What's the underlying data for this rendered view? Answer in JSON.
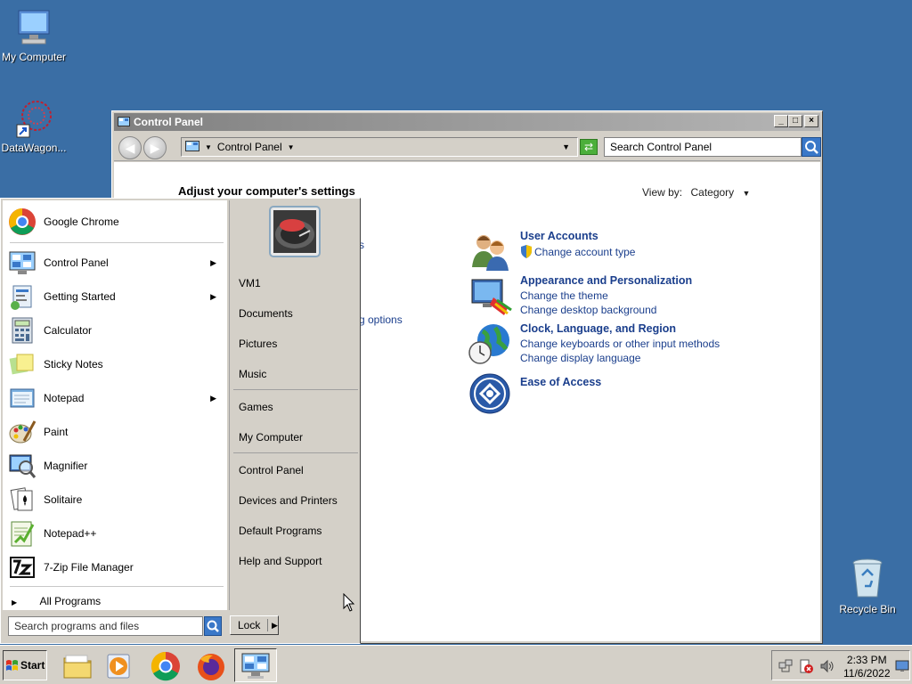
{
  "desktop": {
    "icons": [
      {
        "label": "My Computer"
      },
      {
        "label": "DataWagon..."
      },
      {
        "label": "Recycle Bin"
      }
    ]
  },
  "control_panel": {
    "title": "Control Panel",
    "address": "Control Panel",
    "search_placeholder": "Search Control Panel",
    "heading": "Adjust your computer's settings",
    "view_by_label": "View by:",
    "view_by_value": "Category",
    "partial_links": [
      "s",
      "g options"
    ],
    "categories": [
      {
        "title": "User Accounts",
        "links": [
          "Change account type"
        ]
      },
      {
        "title": "Appearance and Personalization",
        "links": [
          "Change the theme",
          "Change desktop background"
        ]
      },
      {
        "title": "Clock, Language, and Region",
        "links": [
          "Change keyboards or other input methods",
          "Change display language"
        ]
      },
      {
        "title": "Ease of Access",
        "links": []
      }
    ]
  },
  "start_menu": {
    "pinned": [
      {
        "label": "Google Chrome"
      }
    ],
    "programs": [
      {
        "label": "Control Panel",
        "has_submenu": true
      },
      {
        "label": "Getting Started",
        "has_submenu": true
      },
      {
        "label": "Calculator",
        "has_submenu": false
      },
      {
        "label": "Sticky Notes",
        "has_submenu": false
      },
      {
        "label": "Notepad",
        "has_submenu": true
      },
      {
        "label": "Paint",
        "has_submenu": false
      },
      {
        "label": "Magnifier",
        "has_submenu": false
      },
      {
        "label": "Solitaire",
        "has_submenu": false
      },
      {
        "label": "Notepad++",
        "has_submenu": false
      },
      {
        "label": "7-Zip File Manager",
        "has_submenu": false
      }
    ],
    "all_programs": "All Programs",
    "search_placeholder": "Search programs and files",
    "right_items": [
      "VM1",
      "Documents",
      "Pictures",
      "Music",
      "Games",
      "My Computer",
      "Control Panel",
      "Devices and Printers",
      "Default Programs",
      "Help and Support"
    ],
    "lock_label": "Lock"
  },
  "taskbar": {
    "start_label": "Start",
    "clock_time": "2:33 PM",
    "clock_date": "11/6/2022"
  }
}
